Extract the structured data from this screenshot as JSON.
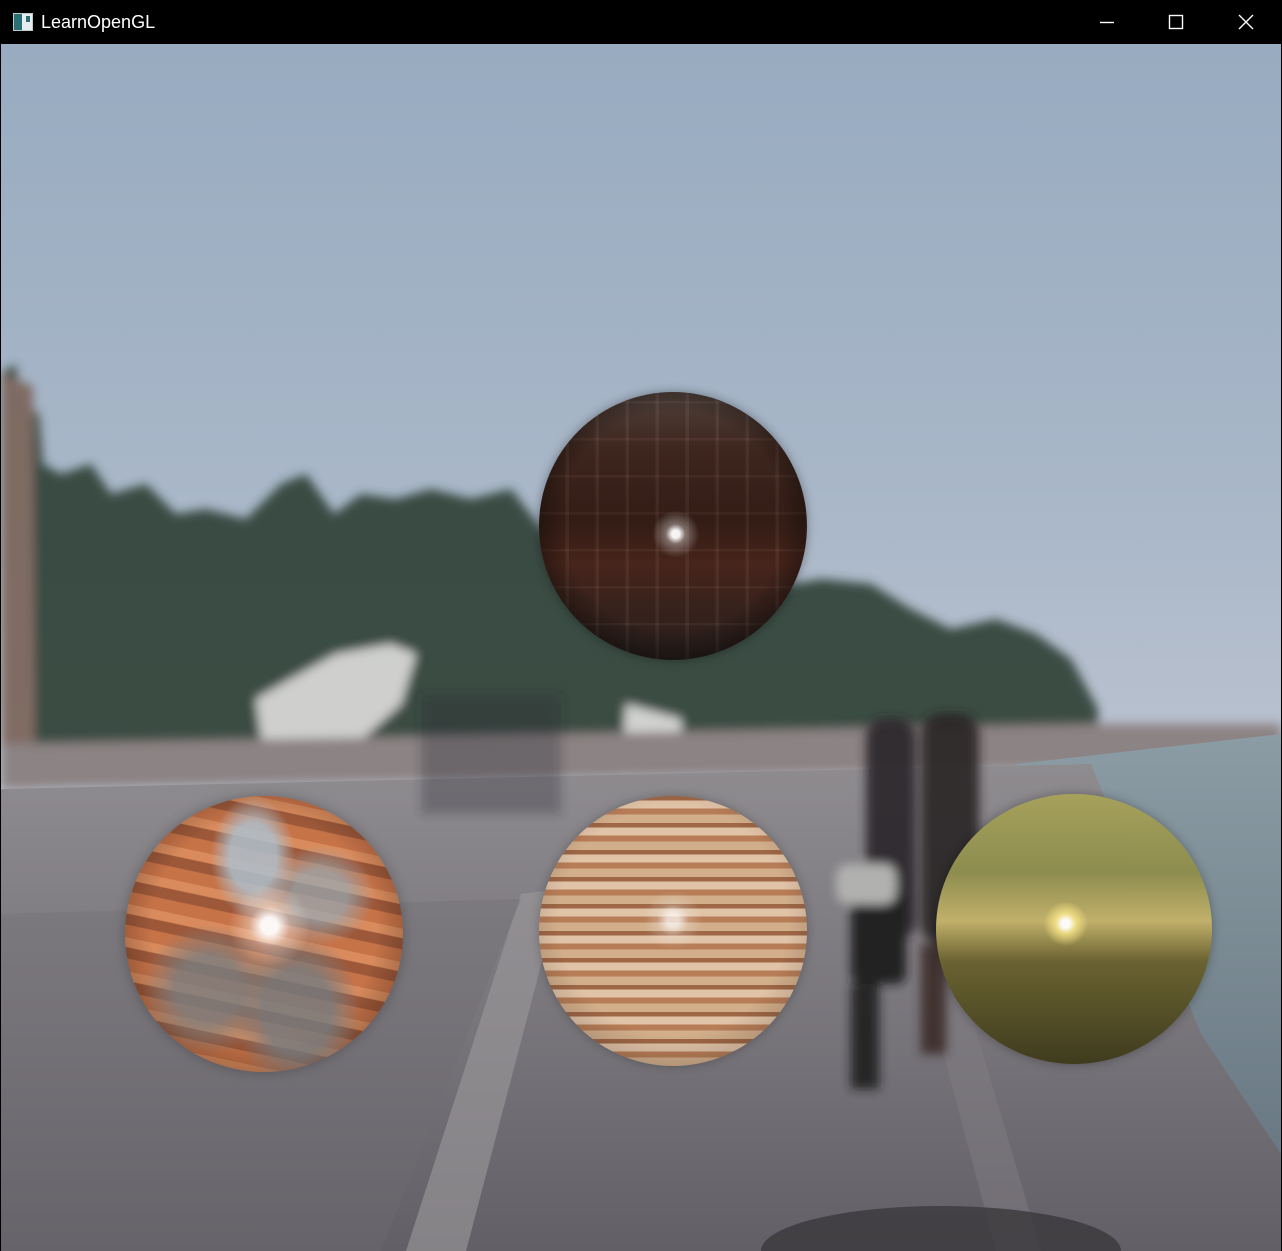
{
  "window": {
    "title": "LearnOpenGL"
  },
  "controls": {
    "minimize": "minimize-icon",
    "maximize": "maximize-icon",
    "close": "close-icon"
  }
}
